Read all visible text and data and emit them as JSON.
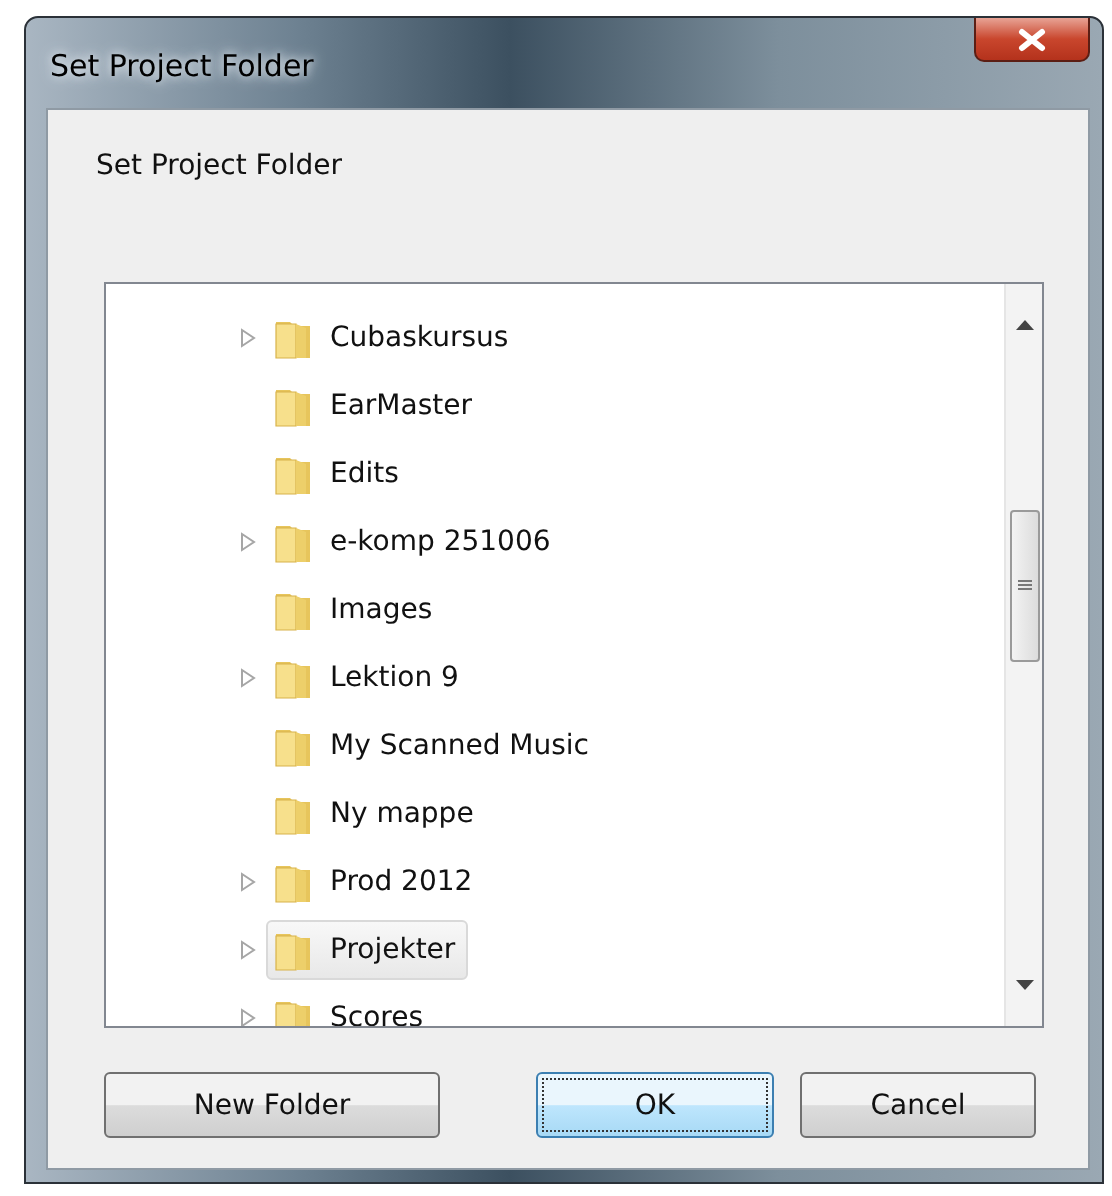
{
  "window": {
    "title": "Set Project Folder"
  },
  "prompt": "Set Project Folder",
  "tree": {
    "items": [
      {
        "label": "Cubaskursus",
        "expandable": true,
        "selected": false
      },
      {
        "label": "EarMaster",
        "expandable": false,
        "selected": false
      },
      {
        "label": "Edits",
        "expandable": false,
        "selected": false
      },
      {
        "label": "e-komp 251006",
        "expandable": true,
        "selected": false
      },
      {
        "label": "Images",
        "expandable": false,
        "selected": false
      },
      {
        "label": "Lektion 9",
        "expandable": true,
        "selected": false
      },
      {
        "label": "My Scanned Music",
        "expandable": false,
        "selected": false
      },
      {
        "label": "Ny mappe",
        "expandable": false,
        "selected": false
      },
      {
        "label": "Prod 2012",
        "expandable": true,
        "selected": false
      },
      {
        "label": "Projekter",
        "expandable": true,
        "selected": true
      },
      {
        "label": "Scores",
        "expandable": true,
        "selected": false
      }
    ]
  },
  "buttons": [
    {
      "label": "New Folder",
      "default": false
    },
    {
      "label": "OK",
      "default": true
    },
    {
      "label": "Cancel",
      "default": false
    }
  ]
}
